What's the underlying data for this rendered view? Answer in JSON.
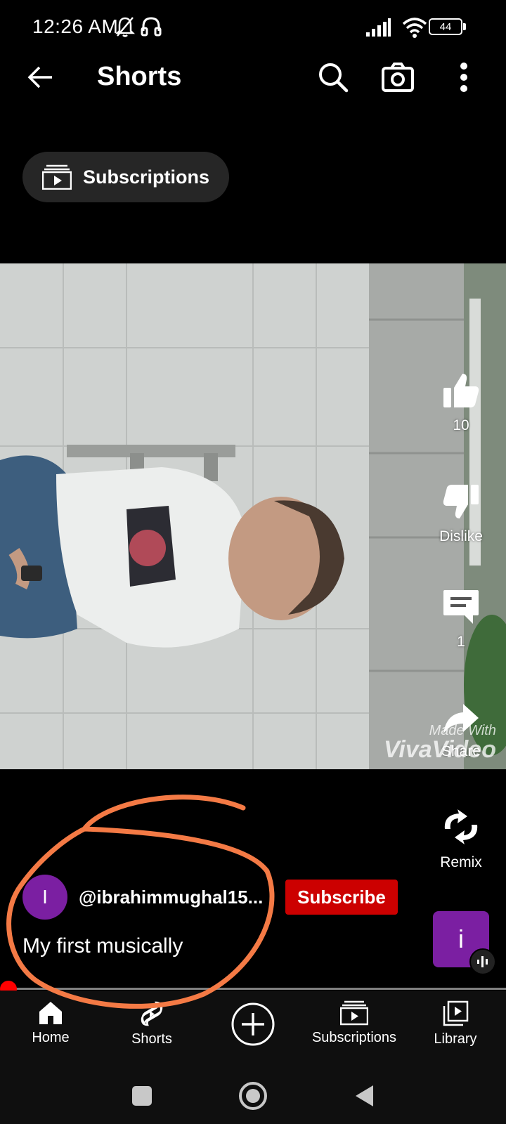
{
  "status_bar": {
    "time": "12:26 AM",
    "battery": "44",
    "icons": [
      "mute-notifications-icon",
      "headset-icon",
      "signal-icon",
      "wifi-icon",
      "battery-icon"
    ]
  },
  "header": {
    "title": "Shorts",
    "actions": [
      "search-icon",
      "camera-icon",
      "more-vert-icon"
    ]
  },
  "chip": {
    "label": "Subscriptions"
  },
  "actions": {
    "like_count": "10",
    "dislike_label": "Dislike",
    "comment_count": "1",
    "share_label": "Share",
    "remix_label": "Remix"
  },
  "watermark": {
    "line1": "Made With",
    "line2": "VivaVideo"
  },
  "channel": {
    "avatar_letter": "I",
    "handle": "@ibrahimmughal15...",
    "subscribe_label": "Subscribe"
  },
  "caption": "My first musically",
  "sound_thumb_letter": "i",
  "progress": {
    "fraction": 0.0
  },
  "bottom_nav": {
    "items": [
      {
        "label": "Home",
        "icon": "home-icon"
      },
      {
        "label": "Shorts",
        "icon": "shorts-icon"
      },
      {
        "label": "",
        "icon": "create-plus-icon"
      },
      {
        "label": "Subscriptions",
        "icon": "subscriptions-icon"
      },
      {
        "label": "Library",
        "icon": "library-icon"
      }
    ]
  },
  "colors": {
    "background": "#000000",
    "subscribe": "#cc0000",
    "avatar": "#7b1fa2",
    "chip": "#262626",
    "scribble": "#f47a45",
    "progress": "#ff0000"
  }
}
